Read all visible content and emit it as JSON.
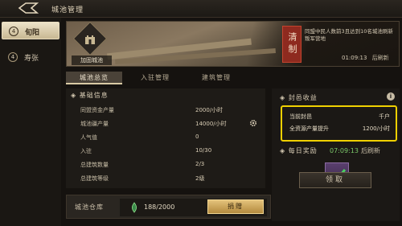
{
  "header": {
    "title": "城池管理"
  },
  "sidebar": {
    "items": [
      {
        "num": "4",
        "label": "旬阳",
        "active": true
      },
      {
        "num": "4",
        "label": "寿张",
        "active": false
      }
    ]
  },
  "banner": {
    "city_name": "加固城池",
    "seal_text": "清制",
    "message": "同盟中民人数前3且达到10名城池刷新叛军营地",
    "timer": "01:09:13",
    "timer_label": "后刷新"
  },
  "tabs": [
    {
      "label": "城池总览",
      "active": true
    },
    {
      "label": "入驻管理",
      "active": false
    },
    {
      "label": "建筑管理",
      "active": false
    }
  ],
  "basic_info": {
    "title": "基础信息",
    "rows": [
      {
        "label": "同盟资金产量",
        "value": "2000/小时"
      },
      {
        "label": "城池疆产量",
        "value": "14000/小时"
      },
      {
        "label": "人气值",
        "value": "0"
      },
      {
        "label": "入驻",
        "value": "10/30"
      },
      {
        "label": "总建筑数量",
        "value": "2/3"
      },
      {
        "label": "总建筑等级",
        "value": "2级"
      }
    ]
  },
  "warehouse": {
    "label": "城池仓库",
    "value": "188/2000",
    "button": "捐赠"
  },
  "fief": {
    "title": "封邑收益",
    "info_icon": "i",
    "rows": [
      {
        "label": "当前封邑",
        "value": "千户"
      },
      {
        "label": "全资源产量提升",
        "value": "1200/小时"
      }
    ]
  },
  "daily_reward": {
    "title": "每日奖励",
    "timer": "07:09:13",
    "timer_label": "后刷新",
    "button": "领取"
  },
  "colors": {
    "highlight": "#f0d000",
    "accent_gold": "#d8c9a4",
    "timer_green": "#7cc86a"
  }
}
